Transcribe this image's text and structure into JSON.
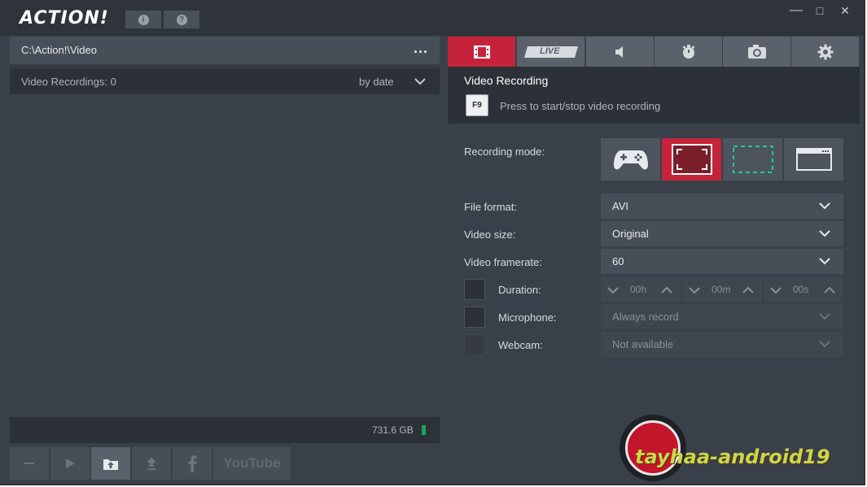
{
  "app": {
    "logo": "ACTION!",
    "info_btn": "i",
    "help_btn": "?",
    "minimize": "—",
    "maximize": "□",
    "close": "✕"
  },
  "left": {
    "path": "C:\\Action!\\Video",
    "path_more": "...",
    "recordings_label": "Video Recordings: 0",
    "sort_label": "by date",
    "disk_free": "731.6 GB"
  },
  "bottom": {
    "youtube_label": "YouTube"
  },
  "right": {
    "tabs": [
      "video-tab",
      "LIVE",
      "audio-tab",
      "benchmark-tab",
      "screenshot-tab",
      "settings-tab"
    ],
    "live_label": "LIVE",
    "section_title": "Video Recording",
    "hotkey": "F9",
    "hotkey_hint": "Press to start/stop video recording",
    "recording_mode_label": "Recording mode:",
    "file_format_label": "File format:",
    "file_format_value": "AVI",
    "video_size_label": "Video size:",
    "video_size_value": "Original",
    "video_framerate_label": "Video framerate:",
    "video_framerate_value": "60",
    "duration_label": "Duration:",
    "duration_hours": "00h",
    "duration_minutes": "00m",
    "duration_seconds": "00s",
    "microphone_label": "Microphone:",
    "microphone_value": "Always record",
    "webcam_label": "Webcam:",
    "webcam_value": "Not available"
  },
  "watermark": "tayhaa-android19",
  "colors": {
    "accent": "#c4233a",
    "bg": "#3a4049",
    "panel_dark": "#2c3037",
    "disk_ok": "#19a55a"
  }
}
